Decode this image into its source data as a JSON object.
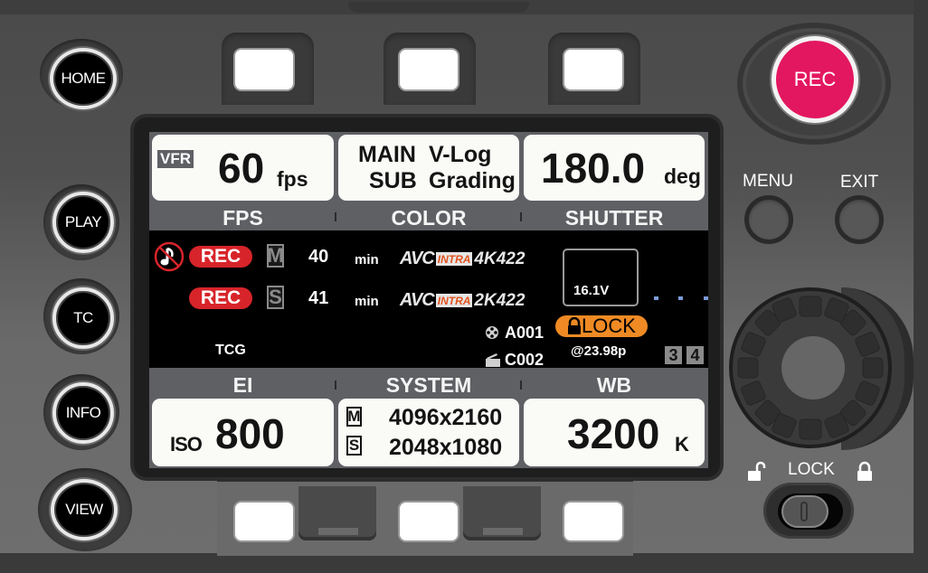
{
  "side_buttons": [
    {
      "label": "HOME"
    },
    {
      "label": "PLAY"
    },
    {
      "label": "TC"
    },
    {
      "label": "INFO"
    },
    {
      "label": "VIEW"
    }
  ],
  "right_controls": {
    "rec_label": "REC",
    "menu_label": "MENU",
    "exit_label": "EXIT",
    "lock_label": "LOCK"
  },
  "top_tiles": {
    "fps": {
      "badge": "VFR",
      "value": "60",
      "unit": "fps"
    },
    "color": {
      "main_key": "MAIN",
      "main_val": "V-Log",
      "sub_key": "SUB",
      "sub_val": "Grading"
    },
    "shutter": {
      "value": "180.0",
      "unit": "deg"
    }
  },
  "top_band": [
    "FPS",
    "COLOR",
    "SHUTTER"
  ],
  "info": {
    "rows": [
      {
        "rec": "REC",
        "slot": "M",
        "remaining": "40",
        "unit": "min",
        "codec": "AVC",
        "codec_badge": "INTRA",
        "format": "4K422"
      },
      {
        "rec": "REC",
        "slot": "S",
        "remaining": "41",
        "unit": "min",
        "codec": "AVC",
        "codec_badge": "INTRA",
        "format": "2K422"
      }
    ],
    "tc_label": "TCG",
    "reel": "A001",
    "clip": "C002",
    "battery": "16.1V",
    "lock_label": "LOCK",
    "genlock_rate": "@23.98p",
    "audio_ch": [
      "3",
      "4"
    ]
  },
  "bottom_band": [
    "EI",
    "SYSTEM",
    "WB"
  ],
  "bottom_tiles": {
    "ei": {
      "prefix": "ISO",
      "value": "800"
    },
    "system": {
      "main_slot": "M",
      "main_res": "4096x2160",
      "sub_slot": "S",
      "sub_res": "2048x1080"
    },
    "wb": {
      "value": "3200",
      "unit": "K"
    }
  },
  "colors": {
    "rec_pill": "#d7242a",
    "rec_button": "#e3175f",
    "lock_badge": "#ef8a24",
    "intra_text": "#e1521d"
  }
}
